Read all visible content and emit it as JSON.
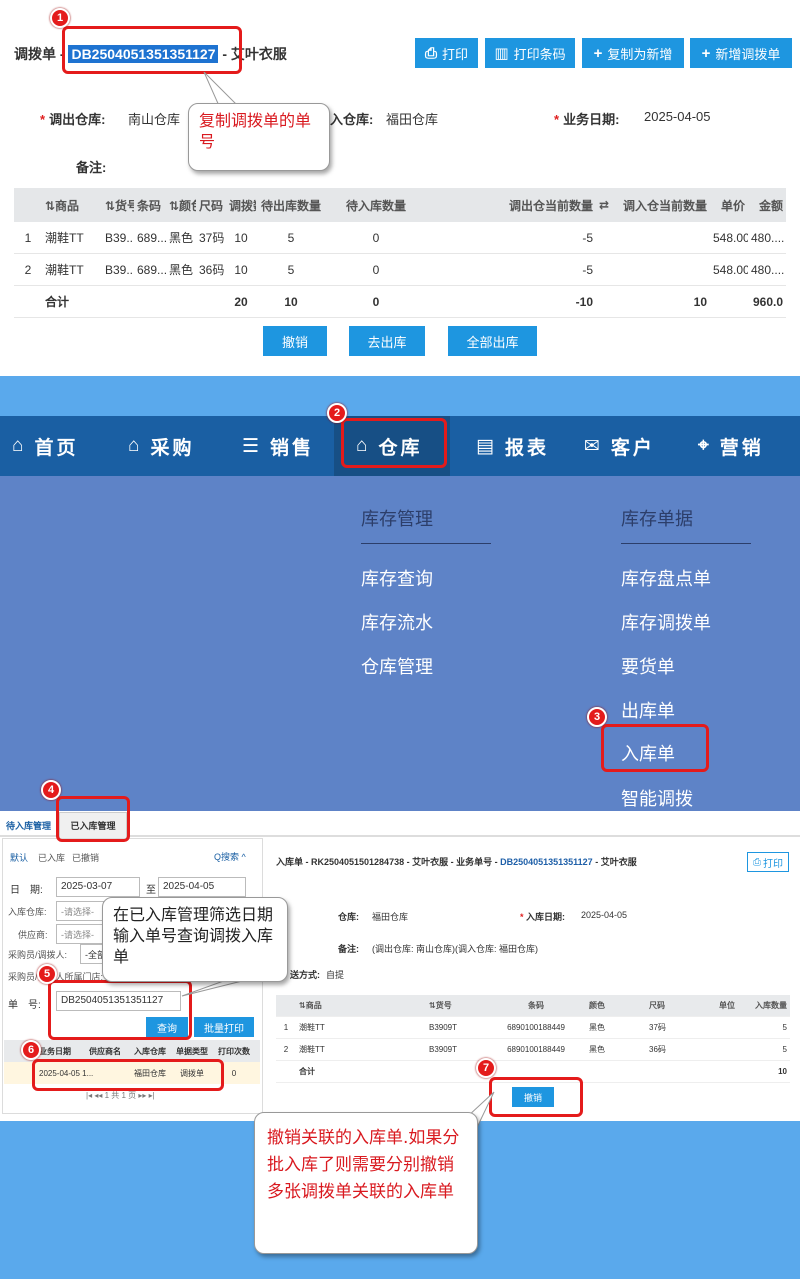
{
  "top": {
    "title_prefix": "调拨单 -",
    "doc_no": "DB2504051351351127",
    "title_suffix": "- 艾叶衣服",
    "btn_print": "打印",
    "btn_print_barcode": "打印条码",
    "btn_copy_new": "复制为新增",
    "btn_new_transfer": "新增调拨单",
    "out_wh_label": "调出仓库:",
    "out_wh_value": "南山仓库",
    "in_wh_label": "入仓库:",
    "in_wh_value": "福田仓库",
    "biz_date_label": "业务日期:",
    "biz_date_value": "2025-04-05",
    "remark_label": "备注:",
    "columns": [
      "",
      "⇅商品",
      "⇅货号",
      "条码",
      "⇅颜色",
      "尺码",
      "调拨数",
      "待出库数量",
      "待入库数量",
      "调出仓当前数量",
      "⇄",
      "调入仓当前数量",
      "单价",
      "金额"
    ],
    "rows": [
      [
        "1",
        "潮鞋TT",
        "B39...",
        "689...",
        "黑色",
        "37码",
        "10",
        "5",
        "0",
        "-5",
        "",
        "",
        "548.00",
        "480...."
      ],
      [
        "2",
        "潮鞋TT",
        "B39...",
        "689...",
        "黑色",
        "36码",
        "10",
        "5",
        "0",
        "-5",
        "",
        "",
        "548.00",
        "480...."
      ]
    ],
    "total": [
      "",
      "合计",
      "",
      "",
      "",
      "",
      "20",
      "10",
      "0",
      "-10",
      "",
      "10",
      "",
      "960.0"
    ],
    "btn_revoke": "撤销",
    "btn_go_out": "去出库",
    "btn_all_out": "全部出库",
    "callout1": "复制调拨单的单号"
  },
  "nav": {
    "items": [
      {
        "icon": "⌂",
        "label": "首页"
      },
      {
        "icon": "⌂",
        "label": "采购"
      },
      {
        "icon": "☰",
        "label": "销售"
      },
      {
        "icon": "⌂",
        "label": "仓库"
      },
      {
        "icon": "▤",
        "label": "报表"
      },
      {
        "icon": "✉",
        "label": "客户"
      },
      {
        "icon": "⌖",
        "label": "营销"
      }
    ],
    "col1_header": "库存管理",
    "col1_items": [
      "库存查询",
      "库存流水",
      "仓库管理"
    ],
    "col2_header": "库存单据",
    "col2_items": [
      "库存盘点单",
      "库存调拨单",
      "要货单",
      "出库单",
      "入库单",
      "智能调拨"
    ]
  },
  "bottom": {
    "tab_pending": "待入库管理",
    "tab_done": "已入库管理",
    "filter_tabs": [
      "默认",
      "已入库",
      "已撤销"
    ],
    "search_label": "搜索",
    "date_label": "日　期:",
    "date_from": "2025-03-07",
    "date_to_label": "至",
    "date_to": "2025-04-05",
    "in_wh_label": "入库仓库:",
    "in_wh_ph": "-请选择-",
    "supplier_label": "供应商:",
    "supplier_ph": "-请选择-",
    "staff_label": "采购员/调拨人:",
    "staff_value": "-全部",
    "staff_store_label": "采购员/调拨人所属门店:",
    "docno_label": "单　号:",
    "docno_value": "DB2504051351351127",
    "btn_query": "查询",
    "btn_batch_print": "批量打印",
    "list_columns": [
      "",
      "",
      "业务日期",
      "供应商名",
      "入库仓库",
      "单据类型",
      "打印次数"
    ],
    "list_row": [
      "",
      "",
      "2025-04-05 1...",
      "",
      "福田仓库",
      "调拨单",
      "0"
    ],
    "pager": "|◂ ◂◂ 1 共 1 页 ▸▸ ▸|",
    "detail_title_prefix": "入库单 - RK2504051501284738 - 艾叶衣服 - 业务单号 -",
    "detail_doc_no": "DB2504051351351127",
    "detail_title_suffix": "- 艾叶衣服",
    "detail_print": "打印",
    "wh_label": "仓库:",
    "wh_value": "福田仓库",
    "in_date_label": "入库日期:",
    "in_date_value": "2025-04-05",
    "remark_label": "备注:",
    "remark_value": "(调出仓库: 南山仓库)(调入仓库: 福田仓库)",
    "delivery_label": "送方式:",
    "delivery_value": "自提",
    "grid_columns": [
      "",
      "⇅商品",
      "⇅货号",
      "条码",
      "颜色",
      "尺码",
      "单位",
      "入库数量"
    ],
    "grid_rows": [
      [
        "1",
        "潮鞋TT",
        "B3909T",
        "6890100188449",
        "黑色",
        "37码",
        "",
        "5"
      ],
      [
        "2",
        "潮鞋TT",
        "B3909T",
        "6890100188449",
        "黑色",
        "36码",
        "",
        "5"
      ]
    ],
    "grid_total": [
      "",
      "合计",
      "",
      "",
      "",
      "",
      "",
      "10"
    ],
    "btn_revoke": "撤销",
    "callout5": "在已入库管理筛选日期输入单号查询调拨入库单",
    "callout7": "撤销关联的入库单.如果分批入库了则需要分别撤销多张调拨单关联的入库单"
  },
  "badges": [
    "1",
    "2",
    "3",
    "4",
    "5",
    "6",
    "7"
  ]
}
